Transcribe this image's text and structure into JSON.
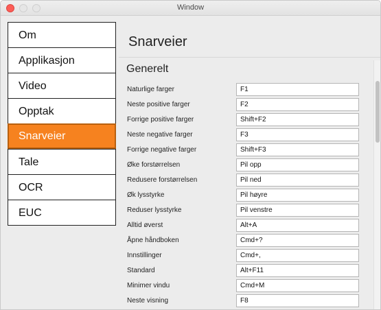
{
  "window": {
    "title": "Window"
  },
  "sidebar": {
    "items": [
      {
        "label": "Om"
      },
      {
        "label": "Applikasjon"
      },
      {
        "label": "Video"
      },
      {
        "label": "Opptak"
      },
      {
        "label": "Snarveier"
      },
      {
        "label": "Tale"
      },
      {
        "label": "OCR"
      },
      {
        "label": "EUC"
      }
    ],
    "active": "Snarveier"
  },
  "main": {
    "title": "Snarveier",
    "section_title": "Generelt",
    "shortcuts": [
      {
        "label": "Naturlige farger",
        "value": "F1"
      },
      {
        "label": "Neste positive farger",
        "value": "F2"
      },
      {
        "label": "Forrige positive farger",
        "value": "Shift+F2"
      },
      {
        "label": "Neste negative farger",
        "value": "F3"
      },
      {
        "label": "Forrige negative farger",
        "value": "Shift+F3"
      },
      {
        "label": "Øke forstørrelsen",
        "value": "Pil opp"
      },
      {
        "label": "Redusere forstørrelsen",
        "value": "Pil ned"
      },
      {
        "label": "Øk lysstyrke",
        "value": "Pil høyre"
      },
      {
        "label": "Reduser lysstyrke",
        "value": "Pil venstre"
      },
      {
        "label": "Alltid øverst",
        "value": "Alt+A"
      },
      {
        "label": "Åpne håndboken",
        "value": "Cmd+?"
      },
      {
        "label": "Innstillinger",
        "value": "Cmd+,"
      },
      {
        "label": "Standard",
        "value": "Alt+F11"
      },
      {
        "label": "Minimer vindu",
        "value": "Cmd+M"
      },
      {
        "label": "Neste visning",
        "value": "F8"
      }
    ]
  },
  "colors": {
    "accent": "#f6821f",
    "close_button": "#fc5d57"
  }
}
